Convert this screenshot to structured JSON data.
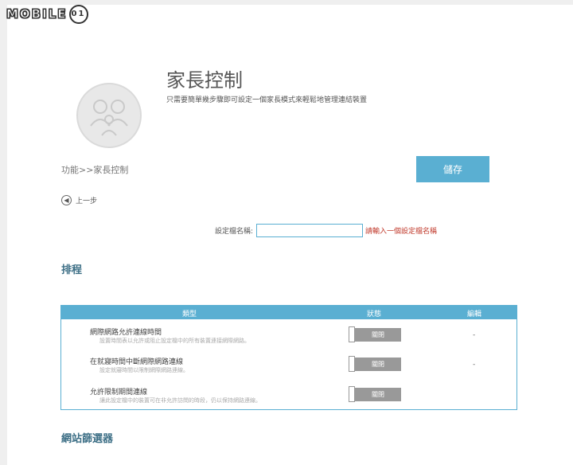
{
  "watermark": {
    "text": "MOBILE",
    "badge": "01"
  },
  "header": {
    "title": "家長控制",
    "subtitle": "只需要簡單幾步驟即可設定一個家長模式來輕鬆地管理連結裝置",
    "avatar_icon": "family-icon"
  },
  "breadcrumb": "功能>>家長控制",
  "save_label": "儲存",
  "back_label": "上一步",
  "profile": {
    "label": "設定檔名稱:",
    "value": "",
    "error": "請輸入一個設定檔名稱"
  },
  "schedule": {
    "title": "排程",
    "columns": {
      "type": "類型",
      "status": "狀態",
      "edit": "編輯"
    },
    "rows": [
      {
        "name": "網際網路允許連線時間",
        "desc": "設置時間表以允許或阻止設定檔中的所有裝置連接網際網路。",
        "status": "關閉",
        "edit": "-"
      },
      {
        "name": "在就寢時間中斷網際網路連線",
        "desc": "設定就寢時間以限制網際網路連線。",
        "status": "關閉",
        "edit": "-"
      },
      {
        "name": "允許限制期間連線",
        "desc": "讓此設定檔中的裝置可在非允許訪問的時段，仍以保持網路連線。",
        "status": "關閉",
        "edit": ""
      }
    ]
  },
  "website_filter": {
    "title": "網站篩選器"
  },
  "colors": {
    "accent": "#5aafd2",
    "error": "#c0392b",
    "section": "#3d6f86"
  }
}
